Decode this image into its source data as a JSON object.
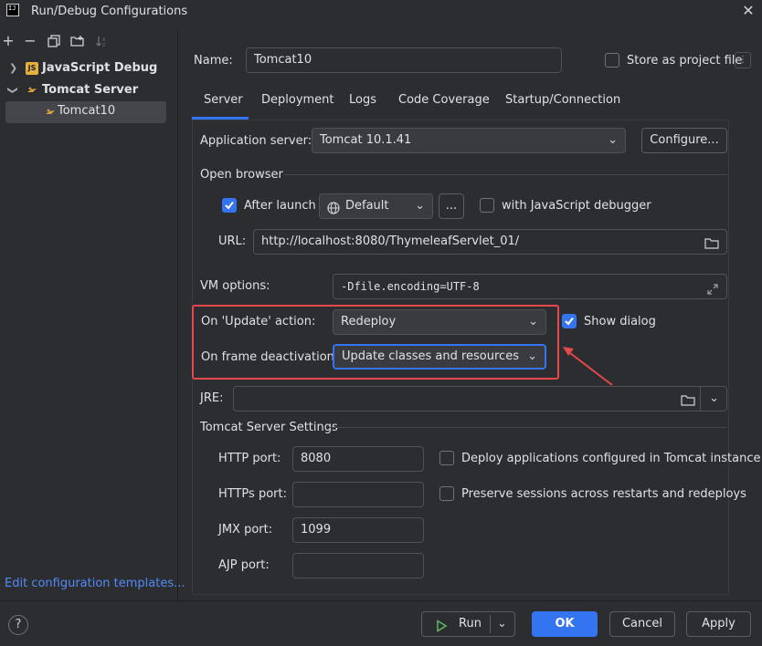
{
  "window": {
    "app_icon_text": "IJ",
    "title": "Run/Debug Configurations"
  },
  "sidebar": {
    "toolbar": [
      "add",
      "remove",
      "copy",
      "new-folder",
      "sort"
    ],
    "tree": [
      {
        "label": "JavaScript Debug",
        "icon": "JS",
        "expanded": false
      },
      {
        "label": "Tomcat Server",
        "expanded": true,
        "children": [
          {
            "label": "Tomcat10",
            "selected": true
          }
        ]
      }
    ],
    "edit_templates_link": "Edit configuration templates..."
  },
  "form": {
    "name_label": "Name:",
    "name_value": "Tomcat10",
    "store_as_project_file": "Store as project file",
    "tabs": [
      "Server",
      "Deployment",
      "Logs",
      "Code Coverage",
      "Startup/Connection"
    ],
    "active_tab": "Server",
    "application_server_label": "Application server:",
    "application_server_value": "Tomcat 10.1.41",
    "configure_button": "Configure...",
    "open_browser_heading": "Open browser",
    "after_launch_label": "After launch",
    "after_launch_checked": true,
    "browser_value": "Default",
    "ellipsis_button": "...",
    "js_debugger_label": "with JavaScript debugger",
    "js_debugger_checked": false,
    "url_label": "URL:",
    "url_value": "http://localhost:8080/ThymeleafServlet_01/",
    "vm_options_label": "VM options:",
    "vm_options_value": "-Dfile.encoding=UTF-8",
    "on_update_label": "On 'Update' action:",
    "on_update_value": "Redeploy",
    "show_dialog_label": "Show dialog",
    "show_dialog_checked": true,
    "on_frame_label": "On frame deactivation:",
    "on_frame_value": "Update classes and resources",
    "jre_label": "JRE:",
    "jre_value": "",
    "tomcat_settings_heading": "Tomcat Server Settings",
    "http_port_label": "HTTP port:",
    "http_port_value": "8080",
    "https_port_label": "HTTPs port:",
    "https_port_value": "",
    "jmx_port_label": "JMX port:",
    "jmx_port_value": "1099",
    "ajp_port_label": "AJP port:",
    "ajp_port_value": "",
    "deploy_apps_label": "Deploy applications configured in Tomcat instance",
    "deploy_apps_checked": false,
    "preserve_sessions_label": "Preserve sessions across restarts and redeploys",
    "preserve_sessions_checked": false
  },
  "footer": {
    "help": "?",
    "run_button": "Run",
    "ok_button": "OK",
    "cancel_button": "Cancel",
    "apply_button": "Apply"
  },
  "colors": {
    "accent": "#3574f0",
    "annotation": "#e5474b",
    "background": "#2b2d30",
    "link": "#548af7"
  }
}
